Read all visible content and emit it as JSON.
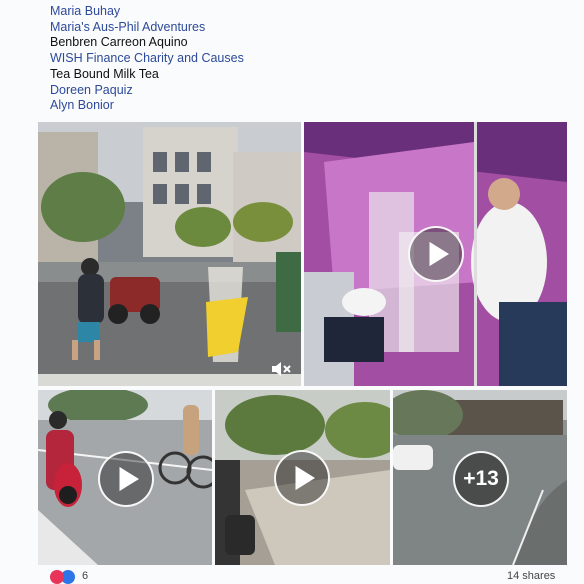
{
  "names": [
    {
      "text": "Maria Buhay",
      "link": true
    },
    {
      "text": "Maria's Aus-Phil Adventures",
      "link": true
    },
    {
      "text": "Benbren Carreon Aquino",
      "link": false
    },
    {
      "text": "WISH Finance Charity and Causes",
      "link": true
    },
    {
      "text": "Tea Bound Milk Tea",
      "link": false
    },
    {
      "text": "Doreen Paquiz",
      "link": true
    },
    {
      "text": "Alyn Bonior",
      "link": true
    }
  ],
  "media": {
    "more_overlay": "+13"
  },
  "footer": {
    "reaction_count": "6",
    "shares": "14 shares"
  },
  "colors": {
    "link": "#2d4a9a",
    "heart": "#e8335a",
    "like": "#2e75e8"
  }
}
